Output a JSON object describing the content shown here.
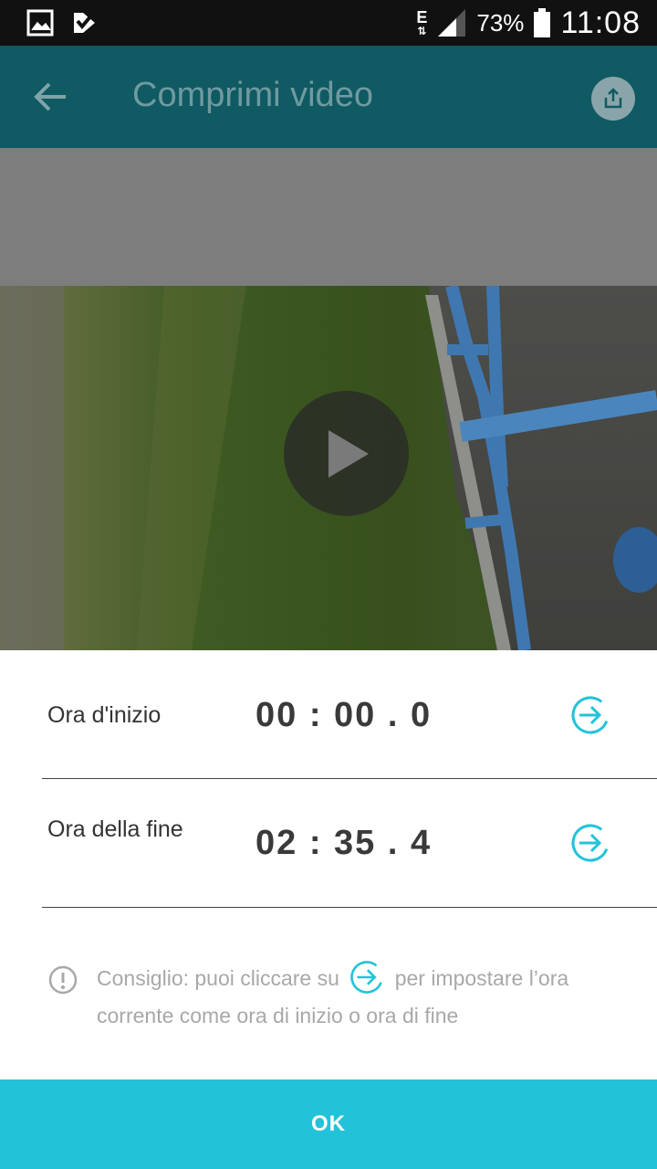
{
  "status_bar": {
    "left_icons": [
      "image-icon",
      "check-notification-icon"
    ],
    "network": "E",
    "battery": "73%",
    "time": "11:08"
  },
  "app_bar": {
    "title": "Comprimi video",
    "back_icon": "arrow-back-icon",
    "share_icon": "share-icon"
  },
  "video": {
    "play_icon": "play-icon"
  },
  "rows": [
    {
      "label": "Ora d'inizio",
      "time": "00 : 00 . 0"
    },
    {
      "label": "Ora della fine",
      "time": "02 : 35 . 4"
    }
  ],
  "tip": {
    "before": "Consiglio: puoi cliccare su",
    "after": "per impostare l’ora corrente come ora di inizio o ora di fine"
  },
  "ok_button": {
    "label": "OK"
  },
  "colors": {
    "app_bar": "#0f5a63",
    "accent": "#22c3d8",
    "status_bar": "#111111"
  }
}
